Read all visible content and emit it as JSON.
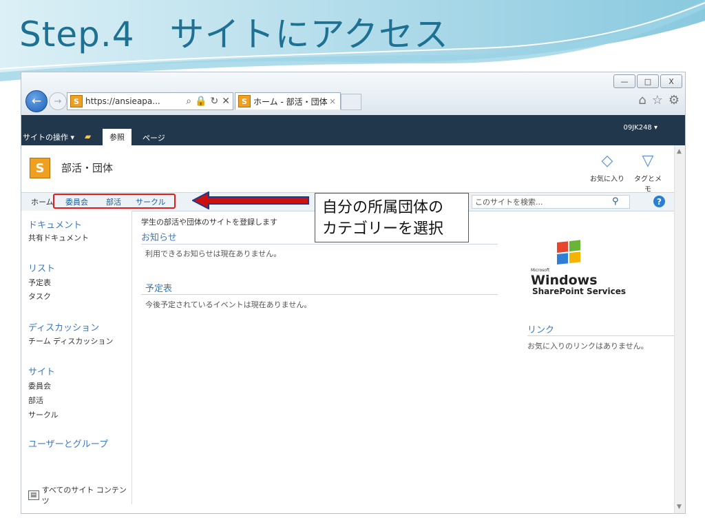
{
  "slide": {
    "title": "Step.4　サイトにアクセス"
  },
  "browser": {
    "url": "https://ansieapa...",
    "tab_title": "ホーム - 部活・団体",
    "tab_close": "×",
    "minimize": "—",
    "maximize": "□",
    "close": "X",
    "back": "←",
    "forward": "→",
    "search_tool": "⌕",
    "lock_tool": "🔒",
    "refresh_tool": "↻",
    "stop_tool": "✕",
    "home_icon": "⌂",
    "favorites_icon": "☆",
    "tools_icon": "⚙",
    "favicon_text": "S"
  },
  "ribbon": {
    "site_actions": "サイトの操作 ▾",
    "tab_browse": "参照",
    "tab_page": "ページ",
    "user": "09JK248 ▾"
  },
  "site": {
    "title": "部活・団体",
    "logo_text": "S",
    "favorite_label": "お気に入り",
    "tags_notes_label": "タグとメモ"
  },
  "topnav": {
    "items": [
      "ホーム",
      "委員会",
      "部活",
      "サークル"
    ],
    "search_placeholder": "このサイトを検索...",
    "help": "?"
  },
  "quicklaunch": {
    "documents": {
      "heading": "ドキュメント",
      "items": [
        "共有ドキュメント"
      ]
    },
    "lists": {
      "heading": "リスト",
      "items": [
        "予定表",
        "タスク"
      ]
    },
    "discussions": {
      "heading": "ディスカッション",
      "items": [
        "チーム ディスカッション"
      ]
    },
    "sites": {
      "heading": "サイト",
      "items": [
        "委員会",
        "部活",
        "サークル"
      ]
    },
    "people": {
      "heading": "ユーザーとグループ"
    },
    "all_content": "すべてのサイト コンテンツ"
  },
  "content": {
    "description": "学生の部活や団体のサイトを登録します",
    "announcements": {
      "title": "お知らせ",
      "empty": "利用できるお知らせは現在ありません。"
    },
    "calendar": {
      "title": "予定表",
      "empty": "今後予定されているイベントは現在ありません。"
    },
    "links": {
      "title": "リンク",
      "empty": "お気に入りのリンクはありません。"
    },
    "logo": {
      "brand_small": "Microsoft",
      "brand": "Windows",
      "product": "SharePoint Services"
    }
  },
  "callout": {
    "line1": "自分の所属団体の",
    "line2": "カテゴリーを選択"
  },
  "colors": {
    "title": "#1e7192",
    "highlight": "#e01b1b",
    "arrow": "#cc1111",
    "ribbon": "#21374c",
    "link": "#3a78c2"
  }
}
